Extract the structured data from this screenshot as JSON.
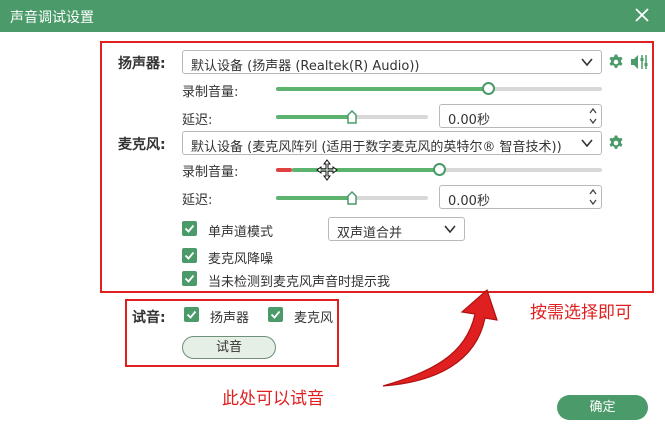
{
  "window": {
    "title": "声音调试设置"
  },
  "speaker": {
    "label": "扬声器:",
    "device": "默认设备 (扬声器 (Realtek(R) Audio))",
    "volume_label": "录制音量:",
    "volume_fraction": 0.65,
    "delay_label": "延迟:",
    "delay_fraction": 0.5,
    "delay_value": "0.00秒"
  },
  "microphone": {
    "label": "麦克风:",
    "device": "默认设备 (麦克风阵列 (适用于数字麦克风的英特尔® 智音技术))",
    "volume_label": "录制音量:",
    "volume_fraction": 0.5,
    "delay_label": "延迟:",
    "delay_fraction": 0.5,
    "delay_value": "0.00秒"
  },
  "options": {
    "mono_label": "单声道模式",
    "mono_checked": true,
    "channel_select": "双声道合并",
    "noise_label": "麦克风降噪",
    "noise_checked": true,
    "notify_label": "当未检测到麦克风声音时提示我",
    "notify_checked": true
  },
  "test": {
    "label": "试音:",
    "speaker_label": "扬声器",
    "mic_label": "麦克风",
    "button": "试音"
  },
  "annotations": {
    "select": "按需选择即可",
    "test": "此处可以试音"
  },
  "footer": {
    "ok_button": "确定"
  },
  "colors": {
    "accent": "#4a9a6a",
    "annotation": "#e02020"
  }
}
